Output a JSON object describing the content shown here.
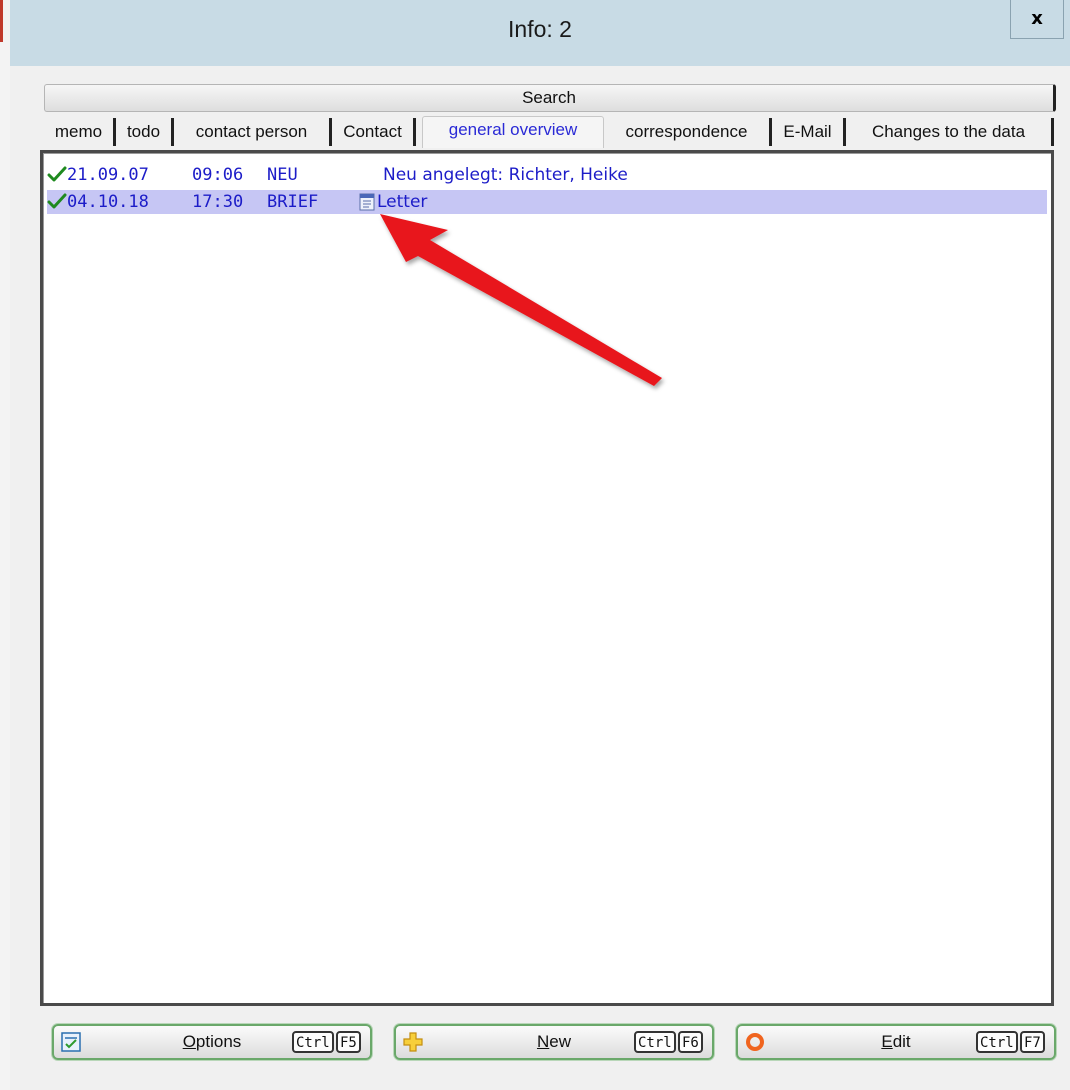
{
  "window": {
    "title": "Info: 2",
    "close_label": "x"
  },
  "search": {
    "label": "Search"
  },
  "tabs": [
    {
      "label": "memo",
      "active": false
    },
    {
      "label": "todo",
      "active": false
    },
    {
      "label": "contact person",
      "active": false
    },
    {
      "label": "Contact",
      "active": false
    },
    {
      "label": "general overview",
      "active": true
    },
    {
      "label": "correspondence",
      "active": false
    },
    {
      "label": "E-Mail",
      "active": false
    },
    {
      "label": "Changes to the data",
      "active": false
    }
  ],
  "rows": [
    {
      "date": "21.09.07",
      "time": "09:06",
      "type": "NEU",
      "text": "Neu angelegt: Richter, Heike",
      "icon": "check-icon",
      "doc_icon": "",
      "selected": false
    },
    {
      "date": "04.10.18",
      "time": "17:30",
      "type": "BRIEF",
      "text": "Letter",
      "icon": "check-icon",
      "doc_icon": "document-icon",
      "selected": true
    }
  ],
  "buttons": [
    {
      "label": "Options",
      "mnemonic": "O",
      "rest": "ptions",
      "key1": "Ctrl",
      "key2": "F5",
      "icon": "options-icon"
    },
    {
      "label": "New",
      "mnemonic": "N",
      "rest": "ew",
      "key1": "Ctrl",
      "key2": "F6",
      "icon": "plus-icon"
    },
    {
      "label": "Edit",
      "mnemonic": "E",
      "rest": "dit",
      "key1": "Ctrl",
      "key2": "F7",
      "icon": "edit-ring-icon"
    }
  ],
  "colors": {
    "titlebar": "#c8dbe5",
    "row_text": "#1c1cc8",
    "selected_row": "#c6c6f4",
    "active_tab_text": "#2a2ad6",
    "check": "#1f8a1f",
    "annotation_arrow": "#e8141b"
  }
}
